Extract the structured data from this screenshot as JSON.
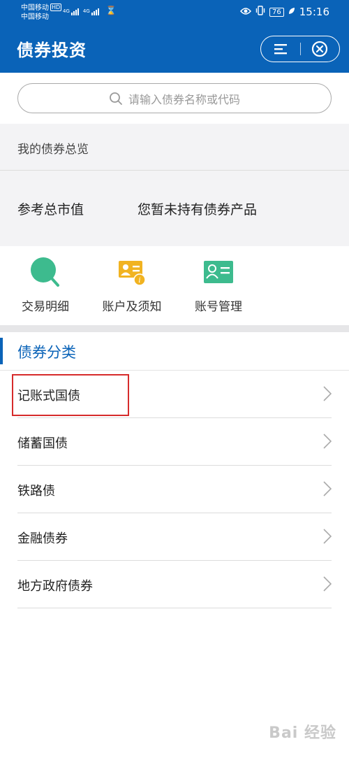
{
  "status_bar": {
    "carrier_1": "中国移动",
    "carrier_hd": "HD",
    "carrier_2": "中国移动",
    "net_1": "4G",
    "net_2": "4G",
    "battery": "76",
    "time": "15:16"
  },
  "header": {
    "title": "债券投资",
    "background": "#0a63b8"
  },
  "search": {
    "placeholder": "请输入债券名称或代码"
  },
  "overview": {
    "title": "我的债券总览",
    "market_value_label": "参考总市值",
    "market_value_text": "您暂未持有债券产品"
  },
  "shortcuts": [
    {
      "label": "交易明细",
      "icon": "search-magnifier-icon",
      "color": "#3dbb8e"
    },
    {
      "label": "账户及须知",
      "icon": "account-info-icon",
      "color": "#f1b321"
    },
    {
      "label": "账号管理",
      "icon": "id-card-icon",
      "color": "#3dbb8e"
    }
  ],
  "category": {
    "title": "债券分类",
    "accent": "#0a63b8",
    "items": [
      {
        "label": "记账式国债"
      },
      {
        "label": "储蓄国债"
      },
      {
        "label": "铁路债"
      },
      {
        "label": "金融债券"
      },
      {
        "label": "地方政府债券"
      }
    ]
  },
  "watermark": "Bai 经验"
}
